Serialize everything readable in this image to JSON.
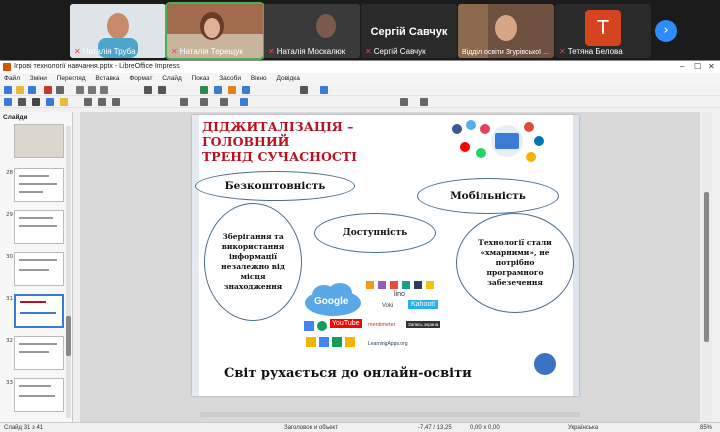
{
  "meeting": {
    "participants": [
      {
        "name": "Наталія Труба"
      },
      {
        "name": "Наталія Терещук"
      },
      {
        "name": "Наталія Москалюк"
      },
      {
        "name": "Сергій Савчук",
        "display": "Сергій Савчук"
      },
      {
        "name": "Відділ освіти Згурівської ..."
      },
      {
        "name": "Тетяна Белова",
        "avatar_letter": "T"
      }
    ],
    "next_icon": "chevron-right-icon"
  },
  "window": {
    "title": "Ігрові технології навчання.pptx - LibreOffice Impress"
  },
  "menu": [
    "Файл",
    "Зміни",
    "Перегляд",
    "Вставка",
    "Формат",
    "Слайд",
    "Показ",
    "Засоби",
    "Вікно",
    "Довідка"
  ],
  "slides_panel": {
    "header": "Слайди",
    "numbers": [
      "28",
      "29",
      "30",
      "31",
      "32",
      "33"
    ]
  },
  "slide": {
    "title_line1": "ДІДЖИТАЛІЗАЦІЯ – ГОЛОВНИЙ",
    "title_line2": "ТРЕНД СУЧАСНОСТІ",
    "bubbles": {
      "cost": "Безкоштовність",
      "mobility": "Мобільність",
      "storage": "Зберігання та використання інформації незалежно від місця знаходження",
      "access": "Доступність",
      "cloud": "Технології стали «хмарними», не потрібно програмного забезечення"
    },
    "logos": {
      "google": "Google",
      "youtube": "YouTube",
      "kahoot": "Kahoot!",
      "voki": "Voki",
      "lino": "lino",
      "learningapps": "LearningApps.org",
      "mentimeter": "mentimeter",
      "padlet": "Запись экрана"
    },
    "footer": "Світ рухається до онлайн-освіти"
  },
  "statusbar": {
    "slide_info": "Слайд 31 з 41",
    "layout": "Заголовок и объект",
    "position": "-7,47 / 13,25",
    "size": "0,00 x 0,00",
    "language": "Українська",
    "zoom": "85%"
  }
}
